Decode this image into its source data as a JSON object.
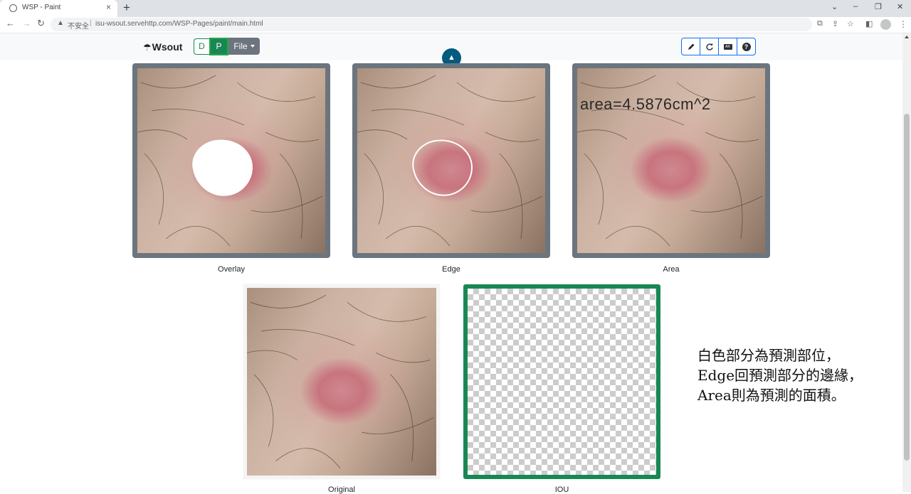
{
  "browser": {
    "tab_title": "WSP - Paint",
    "tab_close": "×",
    "new_tab": "+",
    "security_label": "不安全",
    "url": "isu-wsout.servehttp.com/WSP-Pages/paint/main.html"
  },
  "app": {
    "brand": "Wsout",
    "mode_buttons": {
      "d": "D",
      "p": "P"
    },
    "file_menu": "File",
    "toggle_symbol": "▲",
    "tools": [
      {
        "name": "pen",
        "icon": "pen-icon"
      },
      {
        "name": "refresh",
        "icon": "refresh-icon"
      },
      {
        "name": "ar",
        "icon": "ar-icon",
        "label": "AR"
      },
      {
        "name": "help",
        "icon": "help-icon",
        "label": "?"
      }
    ]
  },
  "panels": {
    "overlay": {
      "caption": "Overlay"
    },
    "edge": {
      "caption": "Edge"
    },
    "area": {
      "caption": "Area",
      "measurement": "area=4.5876cm^2"
    },
    "original": {
      "caption": "Original"
    },
    "iou": {
      "caption": "IOU"
    }
  },
  "note": {
    "line1": "白色部分為預測部位，",
    "line2": "Edge回預測部分的邊緣，",
    "line3": "Area則為預測的面積。"
  },
  "colors": {
    "success": "#198754",
    "secondary": "#6c757d",
    "toggle": "#035b7e",
    "primary_outline": "#0d6efd"
  }
}
